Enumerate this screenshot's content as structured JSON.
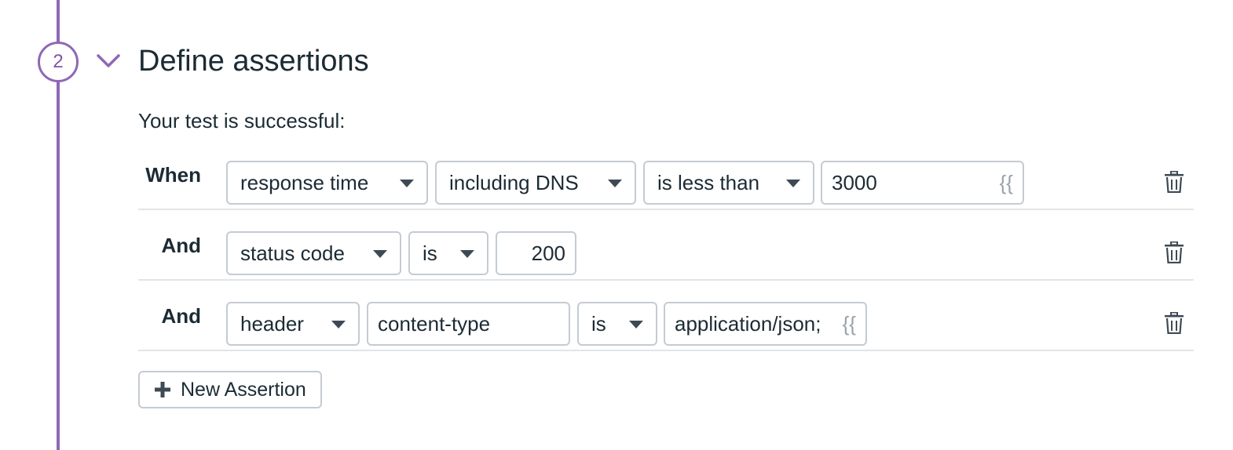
{
  "step": {
    "number": "2",
    "title": "Define assertions"
  },
  "success_text": "Your test is successful:",
  "colors": {
    "accent": "#8f68b6",
    "border": "#c5cbd3",
    "placeholder": "#98a1ab"
  },
  "assertions": [
    {
      "label": "When",
      "type": "response time",
      "dns": "including DNS",
      "operator": "is less than",
      "value": "3000",
      "variable_icon": "{{"
    },
    {
      "label": "And",
      "type": "status code",
      "operator": "is",
      "value": "200"
    },
    {
      "label": "And",
      "type": "header",
      "header_name": "content-type",
      "operator": "is",
      "value": "application/json;",
      "variable_icon": "{{"
    }
  ],
  "new_assertion_label": "New Assertion",
  "icons": [
    "chevron-down-icon",
    "trash-icon",
    "plus-icon"
  ]
}
